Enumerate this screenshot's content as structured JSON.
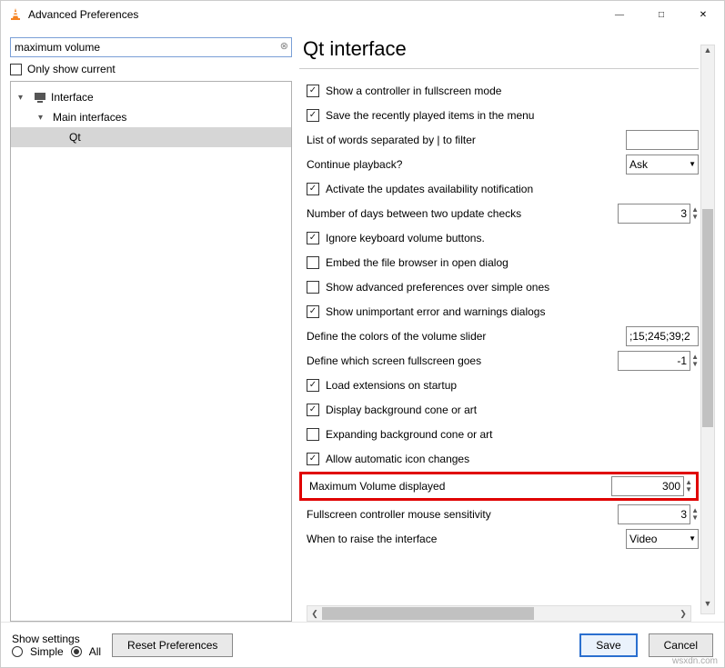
{
  "window": {
    "title": "Advanced Preferences"
  },
  "search": {
    "value": "maximum volume",
    "only_show_label": "Only show current"
  },
  "tree": {
    "root": "Interface",
    "child": "Main interfaces",
    "leaf": "Qt"
  },
  "page": {
    "heading": "Qt interface"
  },
  "settings": [
    {
      "kind": "check",
      "checked": true,
      "label": "Show a controller in fullscreen mode"
    },
    {
      "kind": "check",
      "checked": true,
      "label": "Save the recently played items in the menu"
    },
    {
      "kind": "text",
      "label": "List of words separated by | to filter",
      "value": ""
    },
    {
      "kind": "select",
      "label": "Continue playback?",
      "value": "Ask"
    },
    {
      "kind": "check",
      "checked": true,
      "label": "Activate the updates availability notification"
    },
    {
      "kind": "num",
      "label": "Number of days between two update checks",
      "value": "3"
    },
    {
      "kind": "check",
      "checked": true,
      "label": "Ignore keyboard volume buttons."
    },
    {
      "kind": "check",
      "checked": false,
      "label": "Embed the file browser in open dialog"
    },
    {
      "kind": "check",
      "checked": false,
      "label": "Show advanced preferences over simple ones"
    },
    {
      "kind": "check",
      "checked": true,
      "label": "Show unimportant error and warnings dialogs"
    },
    {
      "kind": "text",
      "label": "Define the colors of the volume slider",
      "value": ";15;245;39;2"
    },
    {
      "kind": "num",
      "label": "Define which screen fullscreen goes",
      "value": "-1"
    },
    {
      "kind": "check",
      "checked": true,
      "label": "Load extensions on startup"
    },
    {
      "kind": "check",
      "checked": true,
      "label": "Display background cone or art"
    },
    {
      "kind": "check",
      "checked": false,
      "label": "Expanding background cone or art"
    },
    {
      "kind": "check",
      "checked": true,
      "label": "Allow automatic icon changes"
    },
    {
      "kind": "num",
      "label": "Maximum Volume displayed",
      "value": "300",
      "highlight": true
    },
    {
      "kind": "num",
      "label": "Fullscreen controller mouse sensitivity",
      "value": "3"
    },
    {
      "kind": "select",
      "label": "When to raise the interface",
      "value": "Video"
    }
  ],
  "footer": {
    "show_settings": "Show settings",
    "simple": "Simple",
    "all": "All",
    "reset": "Reset Preferences",
    "save": "Save",
    "cancel": "Cancel"
  },
  "watermark": "wsxdn.com"
}
